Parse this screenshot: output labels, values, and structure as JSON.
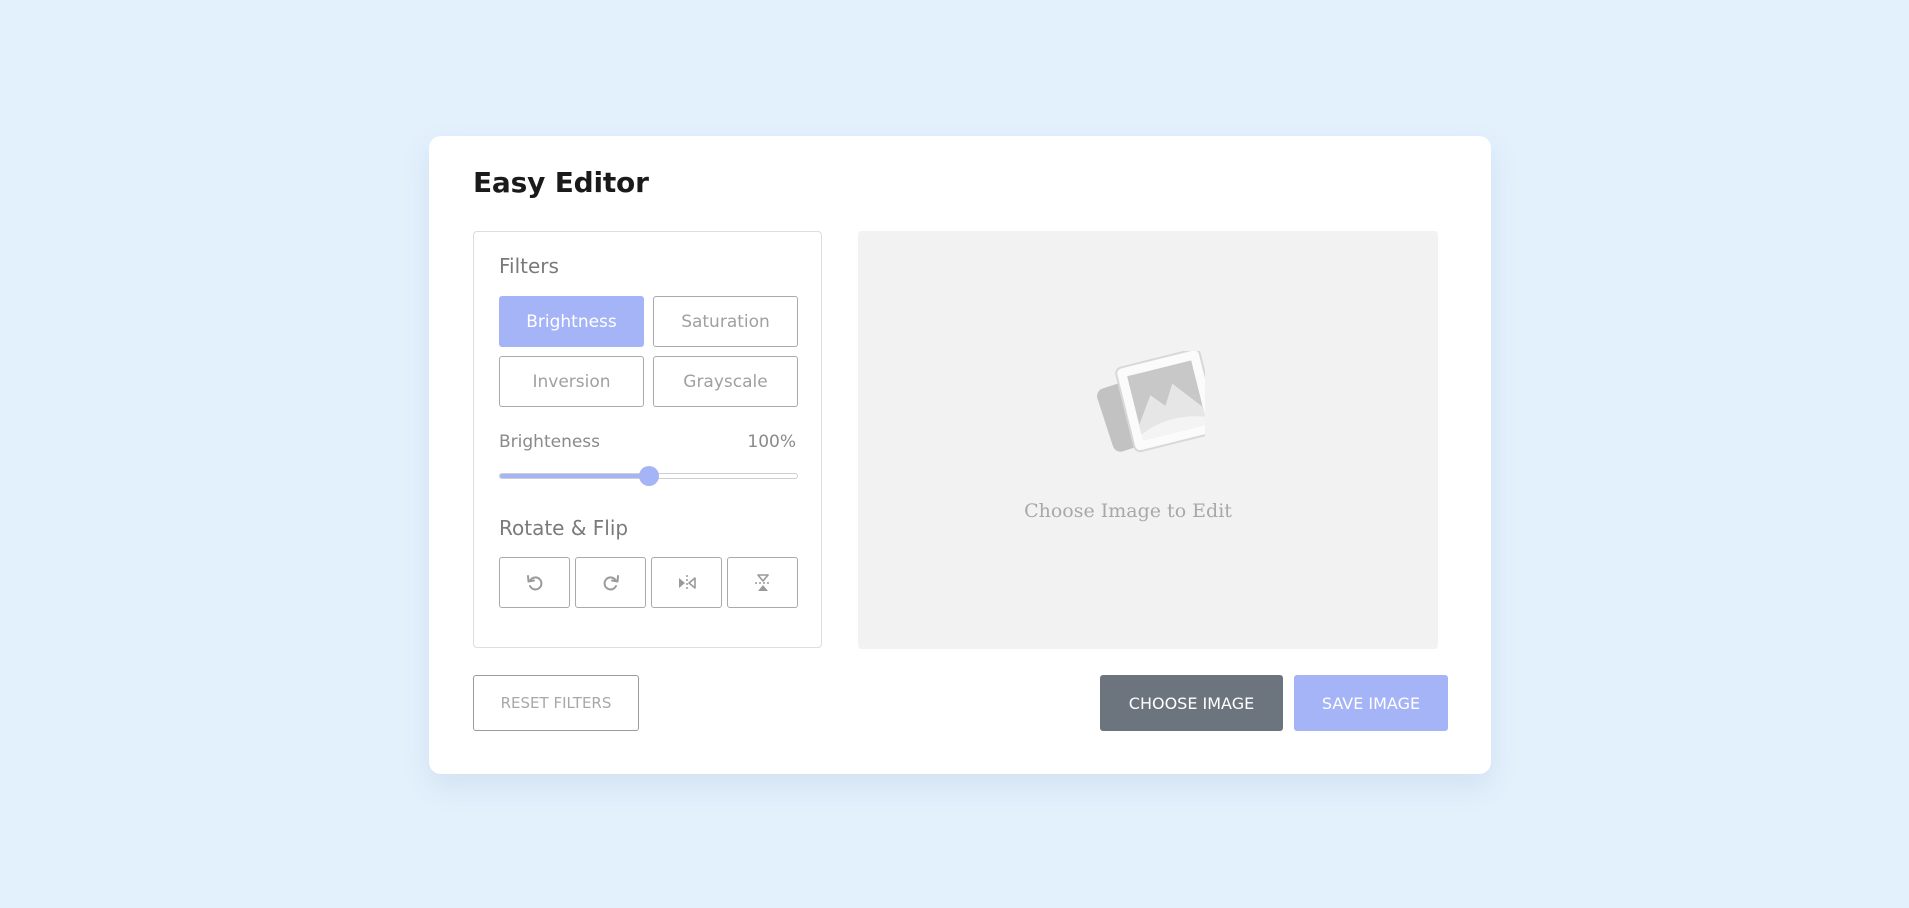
{
  "app": {
    "title": "Easy Editor"
  },
  "filters": {
    "heading": "Filters",
    "buttons": [
      {
        "label": "Brightness",
        "active": true
      },
      {
        "label": "Saturation",
        "active": false
      },
      {
        "label": "Inversion",
        "active": false
      },
      {
        "label": "Grayscale",
        "active": false
      }
    ],
    "slider": {
      "label": "Brighteness",
      "value_text": "100%",
      "fraction": 0.5
    }
  },
  "rotate_flip": {
    "heading": "Rotate & Flip",
    "buttons": [
      {
        "icon": "rotate-left-icon"
      },
      {
        "icon": "rotate-right-icon"
      },
      {
        "icon": "flip-horizontal-icon"
      },
      {
        "icon": "flip-vertical-icon"
      }
    ]
  },
  "preview": {
    "placeholder_text": "Choose Image to Edit",
    "icon": "image-placeholder-icon"
  },
  "actions": {
    "reset_label": "RESET FILTERS",
    "choose_label": "CHOOSE IMAGE",
    "save_label": "SAVE IMAGE"
  },
  "colors": {
    "background": "#e3f1fd",
    "accent": "#a5b4f7",
    "choose_button": "#6c757d",
    "preview_background": "#f2f2f2"
  }
}
